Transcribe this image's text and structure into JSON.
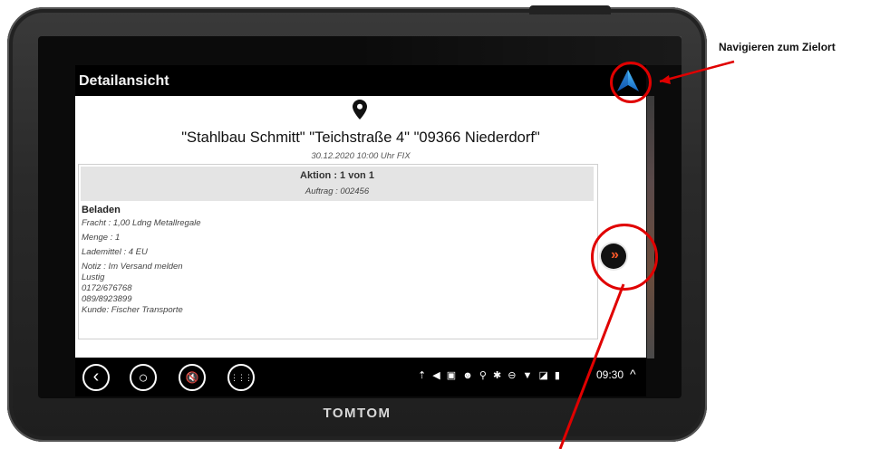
{
  "app": {
    "title": "Detailansicht"
  },
  "destination": {
    "address": "\"Stahlbau Schmitt\" \"Teichstraße 4\" \"09366 Niederdorf\"",
    "datetime": "30.12.2020 10:00 Uhr FIX"
  },
  "action": {
    "title": "Aktion : 1 von 1",
    "order": "Auftrag : 002456"
  },
  "details": {
    "heading": "Beladen",
    "freight": "Fracht : 1,00 Ldng Metallregale",
    "quantity": "Menge : 1",
    "loading_equipment": "Lademittel : 4 EU",
    "note_label": "Notiz : Im Versand melden",
    "note_lines": [
      "Lustig",
      "0172/676768",
      "089/8923899",
      "Kunde: Fischer Transporte"
    ]
  },
  "buttons": {
    "next": "»"
  },
  "navbar": {
    "back": "‹",
    "home": "○",
    "mute": "🔇",
    "apps": "⋮⋮⋮",
    "status_icons": "⇡ ◀ ▣ ☻  ⚲ ✱ ⊖ ▼ ◪ ▮",
    "time": "09:30",
    "expand": "^"
  },
  "device": {
    "brand": "TOMTOM"
  },
  "annotations": {
    "navigate_label": "Navigieren zum Zielort"
  },
  "colors": {
    "accent_next": "#ff5a2a",
    "annotation_red": "#e00000",
    "nav_arrow_top": "#4fc3ff",
    "nav_arrow_bottom": "#1565c0"
  }
}
